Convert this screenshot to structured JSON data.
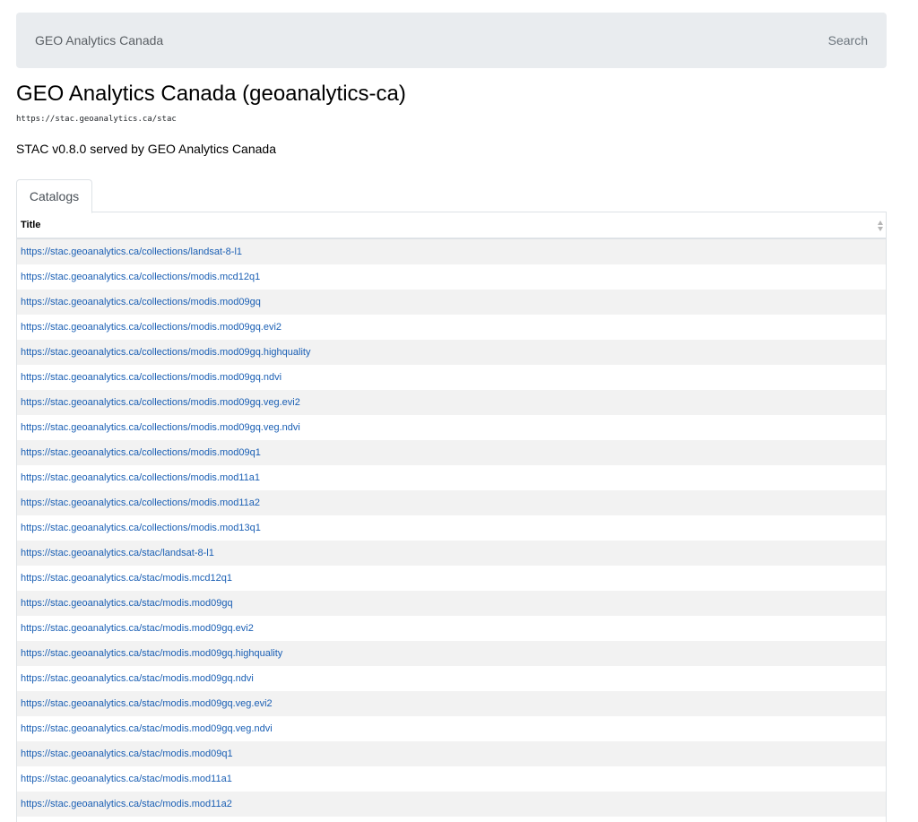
{
  "navbar": {
    "brand": "GEO Analytics Canada",
    "search_label": "Search"
  },
  "header": {
    "title": "GEO Analytics Canada (geoanalytics-ca)",
    "url": "https://stac.geoanalytics.ca/stac",
    "description": "STAC v0.8.0 served by GEO Analytics Canada"
  },
  "tabs": [
    {
      "label": "Catalogs",
      "active": true
    }
  ],
  "table": {
    "column_title": "Title",
    "rows": [
      "https://stac.geoanalytics.ca/collections/landsat-8-l1",
      "https://stac.geoanalytics.ca/collections/modis.mcd12q1",
      "https://stac.geoanalytics.ca/collections/modis.mod09gq",
      "https://stac.geoanalytics.ca/collections/modis.mod09gq.evi2",
      "https://stac.geoanalytics.ca/collections/modis.mod09gq.highquality",
      "https://stac.geoanalytics.ca/collections/modis.mod09gq.ndvi",
      "https://stac.geoanalytics.ca/collections/modis.mod09gq.veg.evi2",
      "https://stac.geoanalytics.ca/collections/modis.mod09gq.veg.ndvi",
      "https://stac.geoanalytics.ca/collections/modis.mod09q1",
      "https://stac.geoanalytics.ca/collections/modis.mod11a1",
      "https://stac.geoanalytics.ca/collections/modis.mod11a2",
      "https://stac.geoanalytics.ca/collections/modis.mod13q1",
      "https://stac.geoanalytics.ca/stac/landsat-8-l1",
      "https://stac.geoanalytics.ca/stac/modis.mcd12q1",
      "https://stac.geoanalytics.ca/stac/modis.mod09gq",
      "https://stac.geoanalytics.ca/stac/modis.mod09gq.evi2",
      "https://stac.geoanalytics.ca/stac/modis.mod09gq.highquality",
      "https://stac.geoanalytics.ca/stac/modis.mod09gq.ndvi",
      "https://stac.geoanalytics.ca/stac/modis.mod09gq.veg.evi2",
      "https://stac.geoanalytics.ca/stac/modis.mod09gq.veg.ndvi",
      "https://stac.geoanalytics.ca/stac/modis.mod09q1",
      "https://stac.geoanalytics.ca/stac/modis.mod11a1",
      "https://stac.geoanalytics.ca/stac/modis.mod11a2"
    ]
  },
  "colors": {
    "link": "#1a5fb4",
    "navbar_bg": "#e9ecef",
    "row_striped": "#f2f2f2"
  },
  "icons": {
    "sort": "sort-both-icon"
  }
}
